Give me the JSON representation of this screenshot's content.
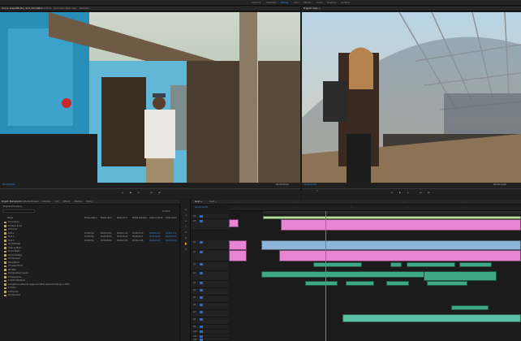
{
  "workspaces": [
    {
      "label": "Learning",
      "active": false
    },
    {
      "label": "Assembly",
      "active": false
    },
    {
      "label": "Editing",
      "active": true
    },
    {
      "label": "Color",
      "active": false
    },
    {
      "label": "Effects",
      "active": false
    },
    {
      "label": "Audio",
      "active": false
    },
    {
      "label": "Graphics",
      "active": false
    },
    {
      "label": "Libraries",
      "active": false
    }
  ],
  "source_monitor": {
    "tabs": [
      "Source: Ocean360_Mix_cam3_001.mp4 ≡",
      "Effect Controls",
      "Audio Track Mixer: Seq1",
      "Metadata"
    ],
    "timecode_left": "00:00:00:00",
    "timecode_right": "00:00:05:01"
  },
  "program_monitor": {
    "tabs": [
      "Program: Seq1 ≡"
    ],
    "timecode_left": "00:00:12:09",
    "timecode_right": "00:00:14:09"
  },
  "project_panel": {
    "tabs": [
      "Project: Premiere Pro ≡",
      "Media Browser",
      "Libraries",
      "Info",
      "Effects",
      "Markers",
      "History"
    ],
    "path": "Premiere Pro.prproj",
    "item_count": "17 Items",
    "columns": [
      "Name",
      "Frame Rate ∧",
      "Media Start",
      "Media End",
      "Media Duration",
      "Video In Point",
      "Video Out P"
    ],
    "rows": [
      {
        "name": "01 Graphics",
        "rate": "",
        "start": "",
        "end": "",
        "dur": "",
        "vin": "",
        "vout": ""
      },
      {
        "name": "02 Music B-roll",
        "rate": "",
        "start": "",
        "end": "",
        "dur": "",
        "vin": "",
        "vout": ""
      },
      {
        "name": "03 Sound",
        "rate": "",
        "start": "",
        "end": "",
        "dur": "",
        "vin": "",
        "vout": ""
      },
      {
        "name": "Shot 1",
        "rate": "23.976 fps",
        "start": "00:00:01:00",
        "end": "00:00:11:12",
        "dur": "00:00:10:13",
        "vin": "00:00:01:00",
        "vout": "00:00:11:12"
      },
      {
        "name": "Shot 2",
        "rate": "23.976 fps",
        "start": "00:00:00:00",
        "end": "00:00:09:20",
        "dur": "00:00:09:21",
        "vin": "00:00:00:00",
        "vout": "00:00:09:20"
      },
      {
        "name": "Shot 3",
        "rate": "23.976 fps",
        "start": "00:00:00:00",
        "end": "00:00:12:05",
        "dur": "00:00:12:06",
        "vin": "00:00:00:00",
        "vout": "00:00:12:05"
      },
      {
        "name": "04_FOOTAGE",
        "rate": "",
        "start": "",
        "end": "",
        "dur": "",
        "vin": "",
        "vout": ""
      },
      {
        "name": "Video & Music",
        "rate": "",
        "start": "",
        "end": "",
        "dur": "",
        "vin": "",
        "vout": ""
      },
      {
        "name": "Bonus B-Roll",
        "rate": "",
        "start": "",
        "end": "",
        "dur": "",
        "vin": "",
        "vout": ""
      },
      {
        "name": "Drone Footage",
        "rate": "",
        "start": "",
        "end": "",
        "dur": "",
        "vin": "",
        "vout": ""
      },
      {
        "name": "05 Voiceover",
        "rate": "",
        "start": "",
        "end": "",
        "dur": "",
        "vin": "",
        "vout": ""
      },
      {
        "name": "06 Graphics",
        "rate": "",
        "start": "",
        "end": "",
        "dur": "",
        "vin": "",
        "vout": ""
      },
      {
        "name": "07 Lower thirds",
        "rate": "",
        "start": "",
        "end": "",
        "dur": "",
        "vin": "",
        "vout": ""
      },
      {
        "name": "08 Titles",
        "rate": "",
        "start": "",
        "end": "",
        "dur": "",
        "vin": "",
        "vout": ""
      },
      {
        "name": "09 Adjustment Layers",
        "rate": "",
        "start": "",
        "end": "",
        "dur": "",
        "vin": "",
        "vout": ""
      },
      {
        "name": "10 Sequences",
        "rate": "",
        "start": "",
        "end": "",
        "dur": "",
        "vin": "",
        "vout": ""
      },
      {
        "name": "11 Extra Elements",
        "rate": "",
        "start": "",
        "end": "",
        "dur": "",
        "vin": "",
        "vout": ""
      },
      {
        "name": "12 Captions elements (Logos and other elements that are in EVE)",
        "rate": "",
        "start": "",
        "end": "",
        "dur": "",
        "vin": "",
        "vout": ""
      },
      {
        "name": "13 Extra",
        "rate": "",
        "start": "",
        "end": "",
        "dur": "",
        "vin": "",
        "vout": ""
      },
      {
        "name": "14 Exports",
        "rate": "",
        "start": "",
        "end": "",
        "dur": "",
        "vin": "",
        "vout": ""
      },
      {
        "name": "zzz Exported",
        "rate": "",
        "start": "",
        "end": "",
        "dur": "",
        "vin": "",
        "vout": ""
      }
    ]
  },
  "timeline": {
    "tabs": [
      "Seq1 ≡",
      "Seq2 ≡"
    ],
    "timecode": "00:00:12:09",
    "tracks": [
      "V4",
      "V3",
      "V2",
      "V1",
      "A1",
      "A2",
      "A3",
      "A4",
      "A5",
      "A6",
      "A7",
      "A8",
      "A9",
      "A10",
      "A11",
      "A12"
    ]
  },
  "colors": {
    "accent": "#3b8de0",
    "video_clip": "#e785d3",
    "audio_clip": "#3fa986"
  }
}
